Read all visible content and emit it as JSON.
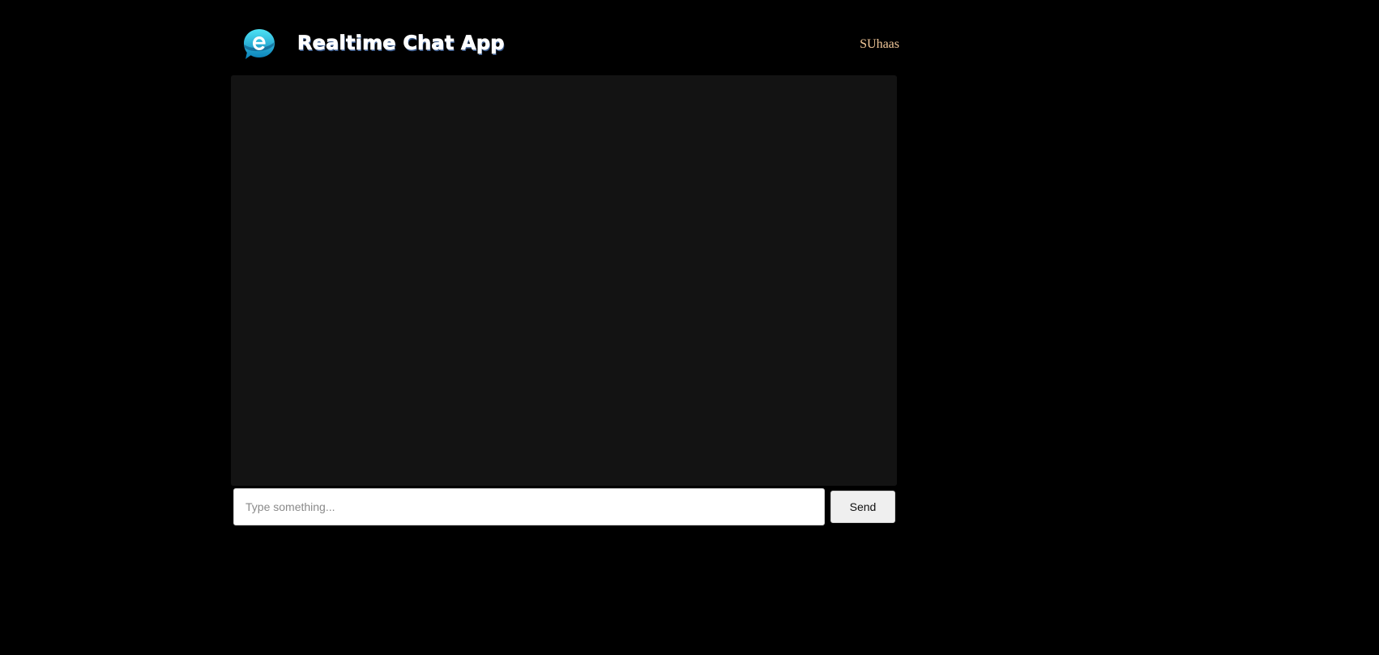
{
  "header": {
    "title": "Realtime Chat App",
    "logo_icon": "chat-bubble-logo-icon",
    "username": "SUhaas"
  },
  "chat": {
    "messages": []
  },
  "composer": {
    "value": "",
    "placeholder": "Type something...",
    "send_label": "Send"
  },
  "colors": {
    "background": "#000000",
    "chat_area": "#131313",
    "username": "#f3c99a",
    "logo_accent": "#1ec8e8"
  }
}
